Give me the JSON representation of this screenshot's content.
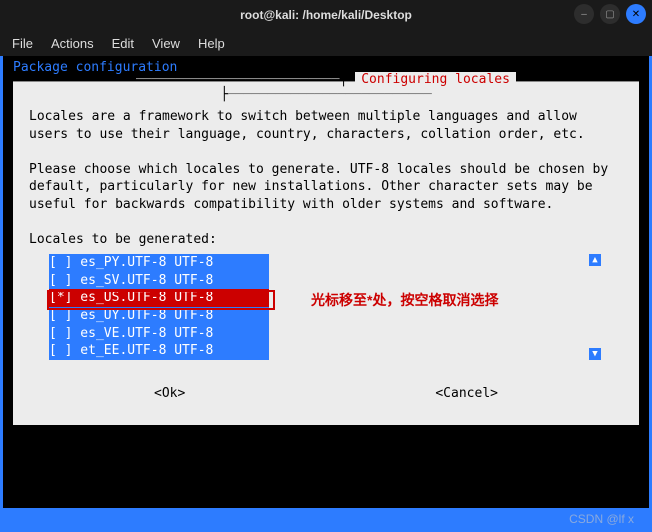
{
  "window": {
    "title": "root@kali: /home/kali/Desktop",
    "icons": {
      "min": "–",
      "max": "▢",
      "close": "✕"
    }
  },
  "menu": {
    "file": "File",
    "actions": "Actions",
    "edit": "Edit",
    "view": "View",
    "help": "Help"
  },
  "term": {
    "pkg_header": "Package configuration"
  },
  "dialog": {
    "title": "Configuring locales",
    "dash": "──────────────────────────",
    "para1": "Locales are a framework to switch between multiple languages and allow users to use their language, country, characters, collation order, etc.",
    "para2": "Please choose which locales to generate. UTF-8 locales should be chosen by default, particularly for new installations. Other character sets may be useful for backwards compatibility with older systems and software.",
    "prompt": "Locales to be generated:",
    "list": {
      "r0": "[ ] es_PY.UTF-8 UTF-8",
      "r1": "[ ] es_SV.UTF-8 UTF-8",
      "r2": "[*] es_US.UTF-8 UTF-8",
      "r3": "[ ] es_UY.UTF-8 UTF-8",
      "r4": "[ ] es_VE.UTF-8 UTF-8",
      "r5": "[ ] et_EE.UTF-8 UTF-8"
    },
    "annotation": "光标移至*处，按空格取消选择",
    "ok": "<Ok>",
    "cancel": "<Cancel>",
    "arrows": {
      "up": "▲",
      "down": "▼"
    }
  },
  "watermark": "CSDN @lf‎ x"
}
